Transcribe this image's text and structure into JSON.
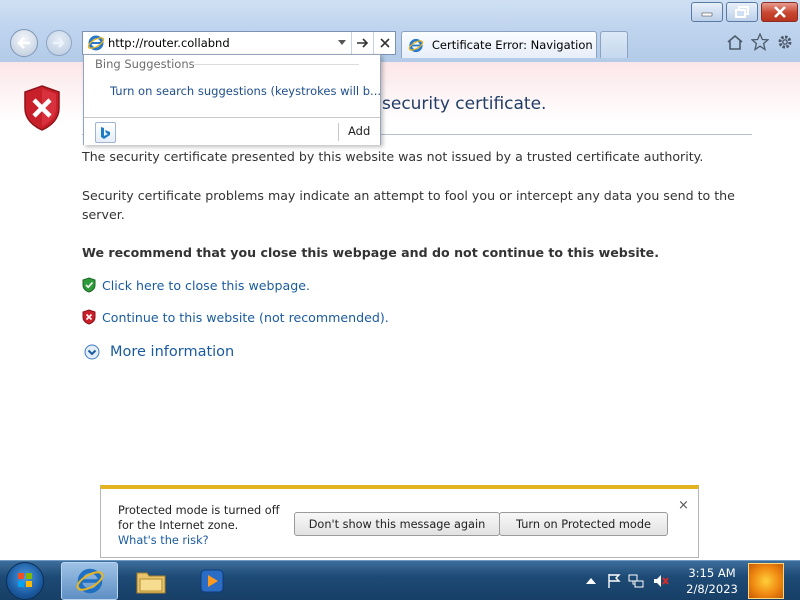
{
  "browser": {
    "address_value": "http://router.collabnd",
    "tab_label": "Certificate Error: Navigation ...",
    "window_buttons": [
      "minimize",
      "maximize",
      "close"
    ]
  },
  "suggestions": {
    "header": "Bing Suggestions",
    "item": "Turn on search suggestions (keystrokes will b...",
    "add_label": "Add"
  },
  "page": {
    "heading": "security certificate.",
    "p1": "The security certificate presented by this website was not issued by a trusted certificate authority.",
    "p2": "Security certificate problems may indicate an attempt to fool you or intercept any data you send to the server.",
    "p3": "We recommend that you close this webpage and do not continue to this website.",
    "link_close": "Click here to close this webpage.",
    "link_continue": "Continue to this website (not recommended).",
    "more_info": "More information"
  },
  "notification": {
    "message": "Protected mode is turned off for the Internet zone.",
    "risk_link": "What's the risk?",
    "btn_dont_show": "Don't show this message again",
    "btn_turn_on": "Turn on Protected mode",
    "close": "×"
  },
  "taskbar": {
    "time": "3:15 AM",
    "date": "2/8/2023"
  },
  "colors": {
    "link": "#1a5b9e",
    "heading": "#1f3d66",
    "notification_accent": "#e2b21f"
  }
}
